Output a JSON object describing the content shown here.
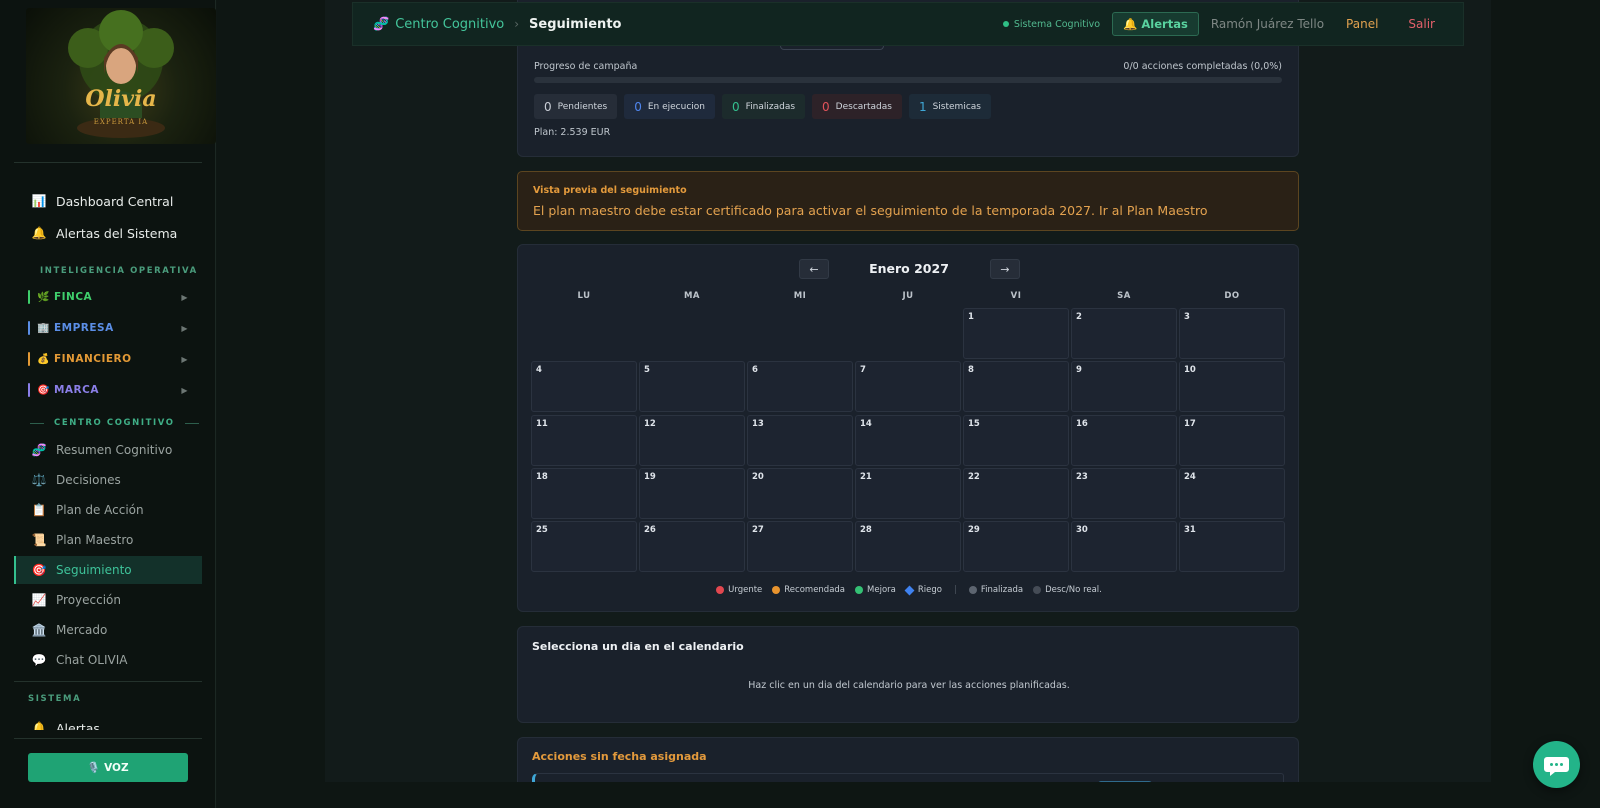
{
  "sidebar": {
    "logo_text": "Olivia",
    "logo_subtext": "EXPERTA IA",
    "top_items": [
      {
        "icon": "chart-icon",
        "glyph": "📊",
        "label": "Dashboard Central"
      },
      {
        "icon": "bell-icon",
        "glyph": "🔔",
        "label": "Alertas del Sistema"
      }
    ],
    "section_intel": "INTELIGENCIA OPERATIVA",
    "groups": [
      {
        "icon": "leaf-icon",
        "glyph": "🌿",
        "label": "FINCA",
        "color": "#3fcf6c"
      },
      {
        "icon": "building-icon",
        "glyph": "🏢",
        "label": "EMPRESA",
        "color": "#5b8ee6"
      },
      {
        "icon": "money-bag-icon",
        "glyph": "💰",
        "label": "FINANCIERO",
        "color": "#e49a36"
      },
      {
        "icon": "target-icon",
        "glyph": "🎯",
        "label": "MARCA",
        "color": "#8b7fe8"
      }
    ],
    "section_cognitivo": "CENTRO COGNITIVO",
    "cog_items": [
      {
        "icon": "dna-icon",
        "glyph": "🧬",
        "label": "Resumen Cognitivo"
      },
      {
        "icon": "scale-icon",
        "glyph": "⚖️",
        "label": "Decisiones"
      },
      {
        "icon": "clipboard-icon",
        "glyph": "📋",
        "label": "Plan de Acción"
      },
      {
        "icon": "scroll-icon",
        "glyph": "📜",
        "label": "Plan Maestro"
      },
      {
        "icon": "target-icon",
        "glyph": "🎯",
        "label": "Seguimiento"
      },
      {
        "icon": "trend-up-icon",
        "glyph": "📈",
        "label": "Proyección"
      },
      {
        "icon": "bank-icon",
        "glyph": "🏛️",
        "label": "Mercado"
      },
      {
        "icon": "chat-bubble-icon",
        "glyph": "💬",
        "label": "Chat OLIVIA"
      }
    ],
    "section_sistema": "SISTEMA",
    "sistema_items": [
      {
        "icon": "bell-icon",
        "glyph": "🔔",
        "label": "Alertas"
      }
    ],
    "voz_label": "🎙️ VOZ"
  },
  "topbar": {
    "breadcrumb_icon": "🧬",
    "breadcrumb_parent": "Centro Cognitivo",
    "breadcrumb_sep": "›",
    "breadcrumb_current": "Seguimiento",
    "system_status": "Sistema Cognitivo",
    "alerts_label": "🔔 Alertas",
    "user_name": "Ramón Juárez Tello",
    "panel_label": "Panel",
    "logout_label": "Salir"
  },
  "campaign": {
    "progress_label": "Progreso de campaña",
    "progress_count": "0/0 acciones completadas (0,0%)",
    "progress_percent": 0,
    "chips": [
      {
        "count": "0",
        "label": "Pendientes",
        "color": "#c9ced6",
        "bg": "#262d38"
      },
      {
        "count": "0",
        "label": "En ejecucion",
        "color": "#4f86ef",
        "bg": "#1f2a3c"
      },
      {
        "count": "0",
        "label": "Finalizadas",
        "color": "#34c08f",
        "bg": "#1c2b2c"
      },
      {
        "count": "0",
        "label": "Descartadas",
        "color": "#e2535b",
        "bg": "#2d2228"
      },
      {
        "count": "1",
        "label": "Sistemicas",
        "color": "#3fa7d6",
        "bg": "#1d2b38"
      }
    ],
    "plan_text": "Plan: 2.539 EUR"
  },
  "warning": {
    "title": "Vista previa del seguimiento",
    "message": "El plan maestro debe estar certificado para activar el seguimiento de la temporada 2027. Ir al Plan Maestro"
  },
  "calendar": {
    "month_label": "Enero 2027",
    "prev_label": "←",
    "next_label": "→",
    "weekdays": [
      "LU",
      "MA",
      "MI",
      "JU",
      "VI",
      "SA",
      "DO"
    ],
    "first_weekday_index": 4,
    "days_in_month": 31,
    "legend": [
      {
        "label": "Urgente",
        "color": "#e2474f",
        "shape": "dot"
      },
      {
        "label": "Recomendada",
        "color": "#e8942e",
        "shape": "dot"
      },
      {
        "label": "Mejora",
        "color": "#34c074",
        "shape": "dot"
      },
      {
        "label": "Riego",
        "color": "#3f82f0",
        "shape": "diamond"
      },
      {
        "label": "Finalizada",
        "color": "#5d6570",
        "shape": "dot"
      },
      {
        "label": "Desc/No real.",
        "color": "#454c56",
        "shape": "dot"
      }
    ]
  },
  "day_detail": {
    "title": "Selecciona un dia en el calendario",
    "hint": "Haz clic en un dia del calendario para ver las acciones planificadas."
  },
  "unscheduled": {
    "title": "Acciones sin fecha asignada"
  }
}
